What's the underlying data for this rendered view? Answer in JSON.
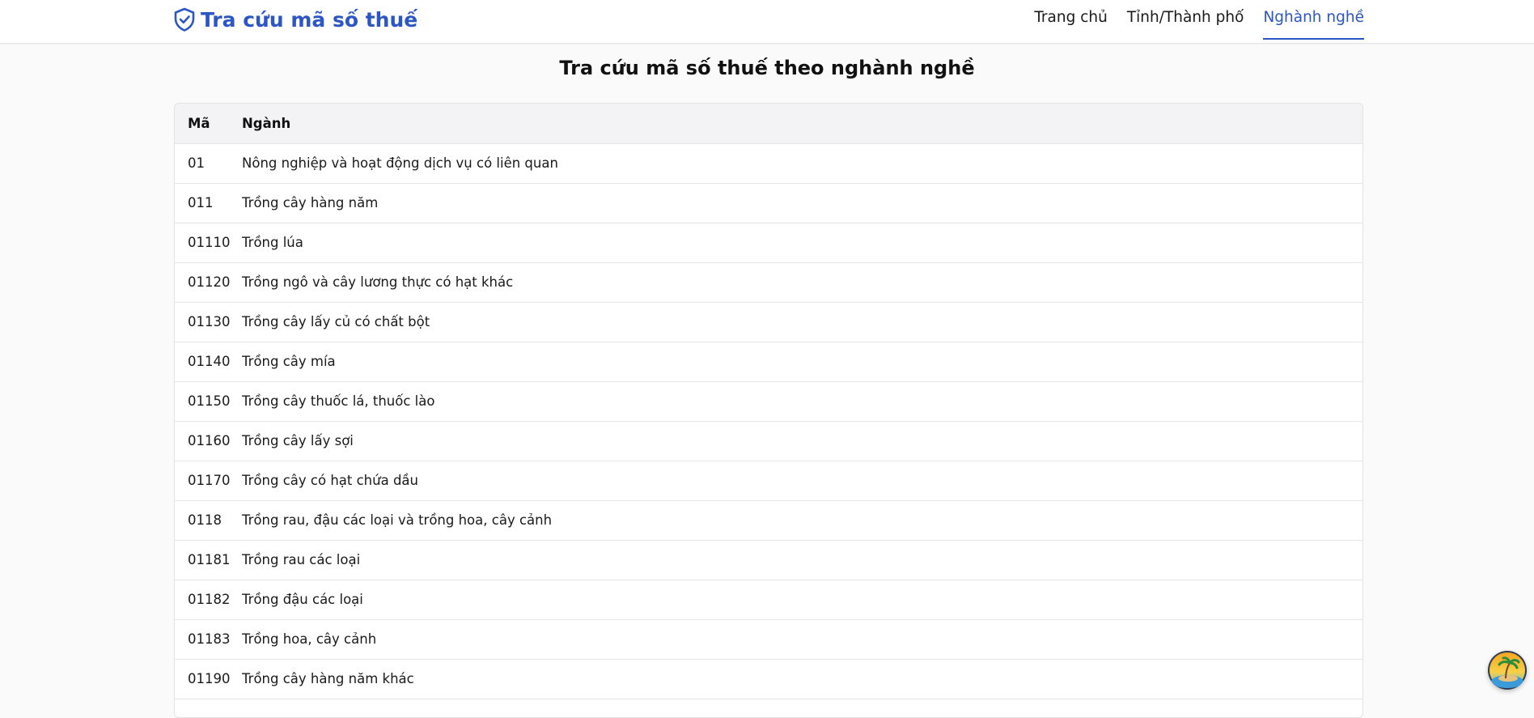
{
  "header": {
    "brand": "Tra cứu mã số thuế",
    "brand_icon": "shield-check-icon",
    "accent_color": "#2b56c4",
    "nav": [
      {
        "label": "Trang chủ",
        "active": false
      },
      {
        "label": "Tỉnh/Thành phố",
        "active": false
      },
      {
        "label": "Nghành nghề",
        "active": true
      }
    ]
  },
  "main": {
    "title": "Tra cứu mã số thuế theo nghành nghề",
    "table": {
      "columns": [
        "Mã",
        "Ngành"
      ],
      "rows": [
        {
          "code": "01",
          "name": "Nông nghiệp và hoạt động dịch vụ có liên quan"
        },
        {
          "code": "011",
          "name": "Trồng cây hàng năm"
        },
        {
          "code": "01110",
          "name": "Trồng lúa"
        },
        {
          "code": "01120",
          "name": "Trồng ngô và cây lương thực có hạt khác"
        },
        {
          "code": "01130",
          "name": "Trồng cây lấy củ có chất bột"
        },
        {
          "code": "01140",
          "name": "Trồng cây mía"
        },
        {
          "code": "01150",
          "name": "Trồng cây thuốc lá, thuốc lào"
        },
        {
          "code": "01160",
          "name": "Trồng cây lấy sợi"
        },
        {
          "code": "01170",
          "name": "Trồng cây có hạt chứa dầu"
        },
        {
          "code": "0118",
          "name": "Trồng rau, đậu các loại và trồng hoa, cây cảnh"
        },
        {
          "code": "01181",
          "name": "Trồng rau các loại"
        },
        {
          "code": "01182",
          "name": "Trồng đậu các loại"
        },
        {
          "code": "01183",
          "name": "Trồng hoa, cây cảnh"
        },
        {
          "code": "01190",
          "name": "Trồng cây hàng năm khác"
        }
      ]
    }
  },
  "widget": {
    "icon": "island-avatar-icon"
  }
}
